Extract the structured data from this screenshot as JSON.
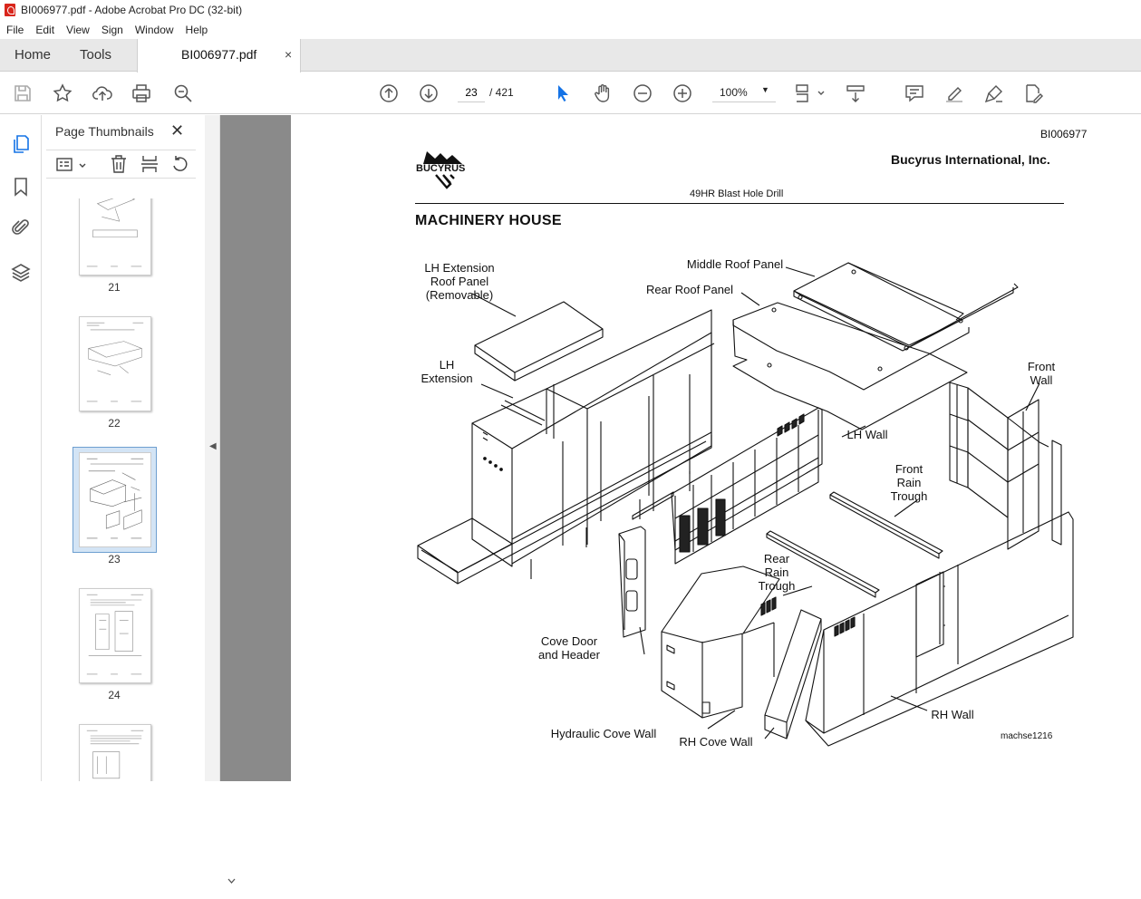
{
  "window": {
    "title": "BI006977.pdf - Adobe Acrobat Pro DC (32-bit)"
  },
  "menu": [
    "File",
    "Edit",
    "View",
    "Sign",
    "Window",
    "Help"
  ],
  "tabs": {
    "home": "Home",
    "tools": "Tools",
    "doc": "BI006977.pdf",
    "close": "×"
  },
  "toolbar": {
    "page_current": "23",
    "page_sep": "/ 421",
    "zoom": "100%"
  },
  "thumbnails": {
    "header": "Page Thumbnails",
    "pages": [
      "21",
      "22",
      "23",
      "24"
    ],
    "selected": "23"
  },
  "document": {
    "doc_id": "BI006977",
    "company": "Bucyrus International, Inc.",
    "logo_text": "BUCYRUS",
    "subtitle": "49HR Blast Hole Drill",
    "heading": "MACHINERY  HOUSE",
    "figure_id": "machse1216",
    "labels": {
      "lh_ext_roof": "LH Extension\nRoof Panel\n(Removable)",
      "lh_ext": "LH\nExtension",
      "middle_roof": "Middle Roof Panel",
      "rear_roof": "Rear Roof Panel",
      "front_wall": "Front\nWall",
      "lh_wall": "LH Wall",
      "front_rain": "Front\nRain\nTrough",
      "rear_rain": "Rear\nRain\nTrough",
      "cove_door": "Cove Door\nand Header",
      "hyd_cove": "Hydraulic Cove Wall",
      "rh_cove": "RH Cove Wall",
      "rh_wall": "RH Wall"
    }
  },
  "colors": {
    "accent": "#1473e6",
    "selected_thumb_bg": "#d3e4f5",
    "doc_bg": "#8a8a8a",
    "pdf_red": "#d9261c"
  }
}
